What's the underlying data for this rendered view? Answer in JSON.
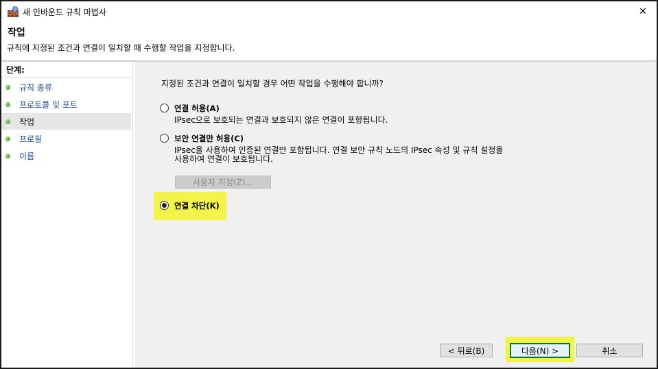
{
  "window": {
    "title": "새 인바운드 규칙 마법사",
    "close_glyph": "✕"
  },
  "header": {
    "title": "작업",
    "description": "규칙에 지정된 조건과 연결이 일치할 때 수행할 작업을 지정합니다."
  },
  "steps": {
    "title": "단계:",
    "items": [
      {
        "label": "규칙 종류",
        "current": false
      },
      {
        "label": "프로토콜 및 포트",
        "current": false
      },
      {
        "label": "작업",
        "current": true
      },
      {
        "label": "프로필",
        "current": false
      },
      {
        "label": "이름",
        "current": false
      }
    ]
  },
  "main": {
    "question": "지정된 조건과 연결이 일치할 경우 어떤 작업을 수행해야 합니까?",
    "options": [
      {
        "label": "연결 허용(A)",
        "description": [
          "IPsec으로 보호되는 연결과 보호되지 않은 연결이 포함됩니다."
        ],
        "selected": false
      },
      {
        "label": "보안 연결만 허용(C)",
        "description": [
          "IPsec을 사용하여 인증된 연결만 포함됩니다. 연결 보안 규칙 노드의 IPsec 속성 및 규칙 설정을",
          "사용하여 연결이 보호됩니다."
        ],
        "selected": false
      },
      {
        "label": "연결 차단(K)",
        "description": [],
        "selected": true
      }
    ],
    "custom_button": "사용자 지정(Z)..."
  },
  "footer": {
    "back": "< 뒤로(B)",
    "next": "다음(N) >",
    "cancel": "취소"
  },
  "colors": {
    "highlight": "#f3f349",
    "step_link": "#1b4fa0",
    "step_dot": "#3a9a28"
  }
}
